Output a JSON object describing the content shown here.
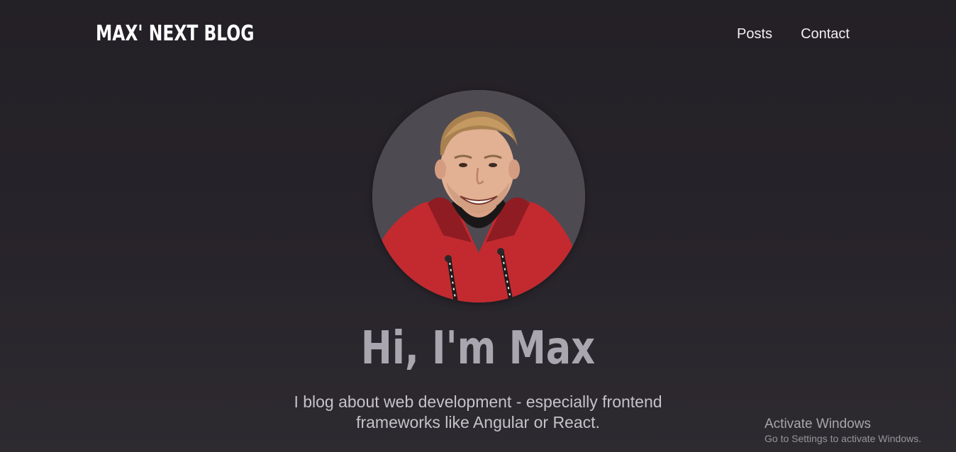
{
  "header": {
    "logo": "MAX' NEXT BLOG",
    "nav": [
      {
        "label": "Posts"
      },
      {
        "label": "Contact"
      }
    ]
  },
  "hero": {
    "avatar_alt": "Portrait of Max",
    "title": "Hi, I'm Max",
    "description": "I blog about web development - especially frontend frameworks like Angular or React."
  },
  "watermark": {
    "title": "Activate Windows",
    "subtitle": "Go to Settings to activate Windows."
  },
  "colors": {
    "background": "#27232a",
    "avatar_bg": "#4d4a52",
    "title": "#a9a6b0",
    "hoodie": "#c22a2f"
  }
}
